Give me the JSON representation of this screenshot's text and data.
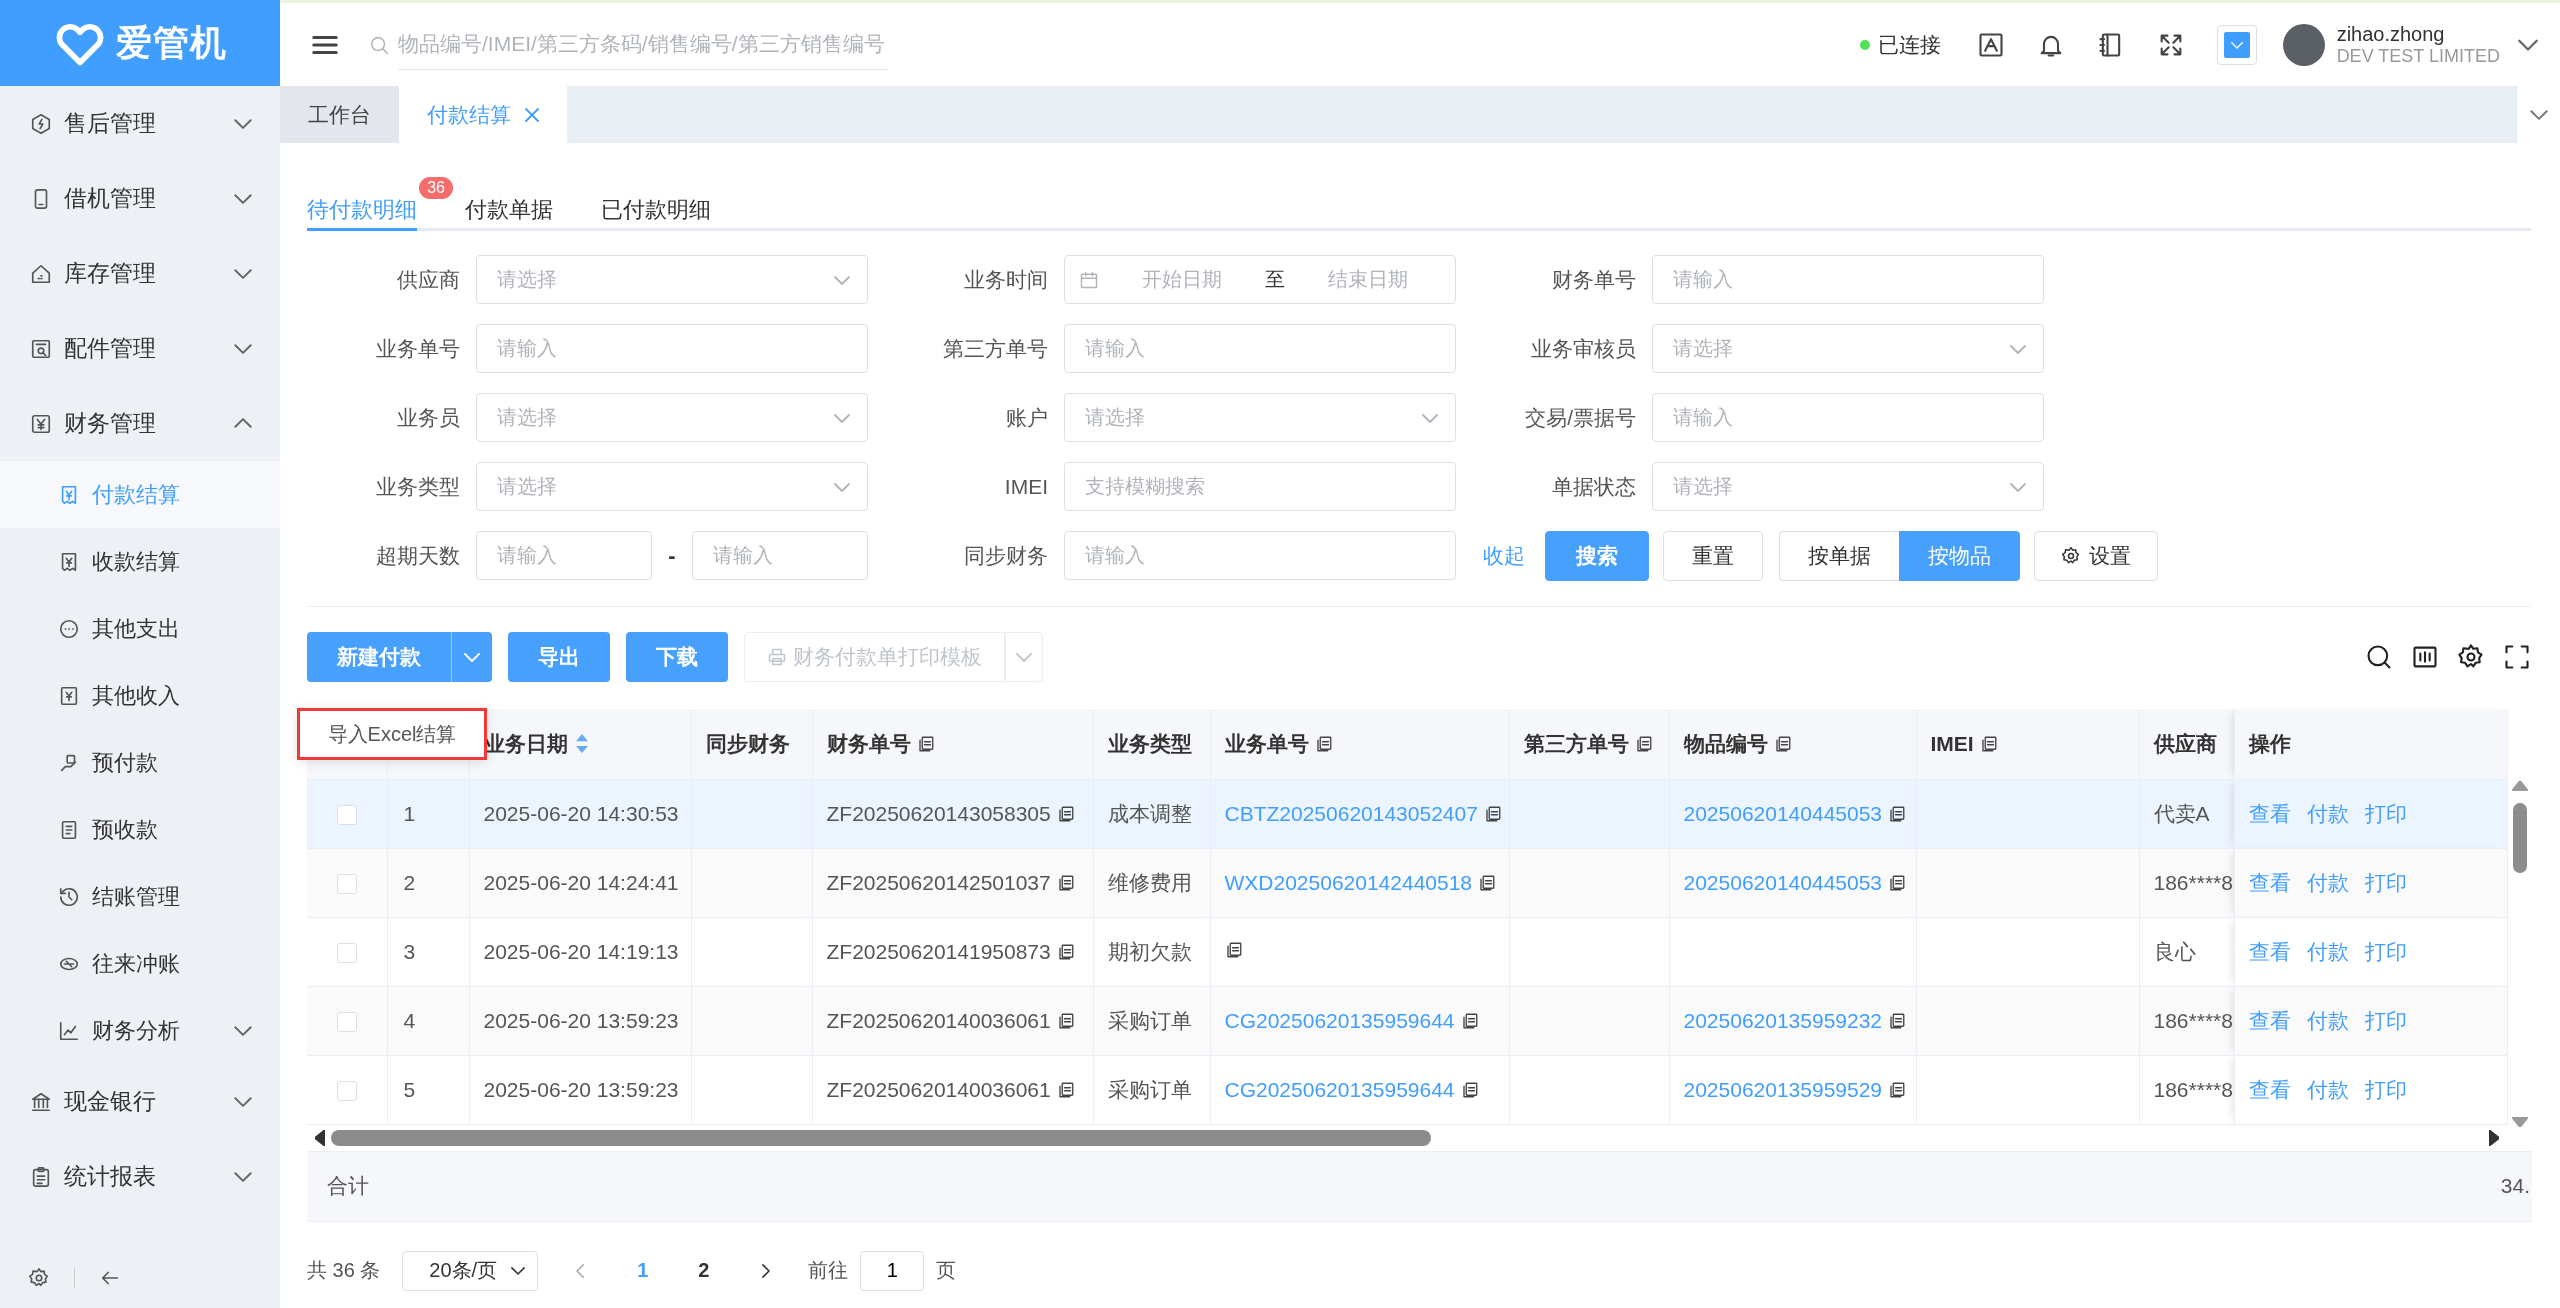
{
  "sidebar": {
    "logo": "爱管机",
    "items": [
      {
        "label": "售后管理",
        "expanded": false,
        "selected": false
      },
      {
        "label": "借机管理",
        "expanded": false,
        "selected": false
      },
      {
        "label": "库存管理",
        "expanded": false,
        "selected": false
      },
      {
        "label": "配件管理",
        "expanded": false,
        "selected": false
      },
      {
        "label": "财务管理",
        "expanded": true,
        "selected": false,
        "children": [
          {
            "label": "付款结算",
            "selected": true
          },
          {
            "label": "收款结算",
            "selected": false
          },
          {
            "label": "其他支出",
            "selected": false
          },
          {
            "label": "其他收入",
            "selected": false
          },
          {
            "label": "预付款",
            "selected": false
          },
          {
            "label": "预收款",
            "selected": false
          },
          {
            "label": "结账管理",
            "selected": false
          },
          {
            "label": "往来冲账",
            "selected": false
          },
          {
            "label": "财务分析",
            "selected": false,
            "expanded": false
          }
        ]
      },
      {
        "label": "现金银行",
        "expanded": false,
        "selected": false
      },
      {
        "label": "统计报表",
        "expanded": false,
        "selected": false
      }
    ]
  },
  "header": {
    "search": {
      "placeholder": "物品编号/IMEI/第三方条码/销售编号/第三方销售编号"
    },
    "connection": {
      "label": "已连接",
      "connected": true
    },
    "user": {
      "name": "zihao.zhong",
      "company": "DEV TEST LIMITED"
    }
  },
  "tabs": [
    {
      "label": "工作台",
      "selected": false,
      "closable": false
    },
    {
      "label": "付款结算",
      "selected": true,
      "closable": true
    }
  ],
  "subtabs": [
    {
      "label": "待付款明细",
      "selected": true,
      "badge": "36"
    },
    {
      "label": "付款单据",
      "selected": false
    },
    {
      "label": "已付款明细",
      "selected": false
    }
  ],
  "filters": [
    {
      "label": "供应商",
      "kind": "select",
      "placeholder": "请选择"
    },
    {
      "label": "业务时间",
      "kind": "daterange",
      "start_placeholder": "开始日期",
      "separator": "至",
      "end_placeholder": "结束日期"
    },
    {
      "label": "财务单号",
      "kind": "input",
      "placeholder": "请输入"
    },
    {
      "label": "业务单号",
      "kind": "input",
      "placeholder": "请输入"
    },
    {
      "label": "第三方单号",
      "kind": "input",
      "placeholder": "请输入"
    },
    {
      "label": "业务审核员",
      "kind": "select",
      "placeholder": "请选择"
    },
    {
      "label": "业务员",
      "kind": "select",
      "placeholder": "请选择"
    },
    {
      "label": "账户",
      "kind": "select",
      "placeholder": "请选择"
    },
    {
      "label": "交易/票据号",
      "kind": "input",
      "placeholder": "请输入"
    },
    {
      "label": "业务类型",
      "kind": "select",
      "placeholder": "请选择"
    },
    {
      "label": "IMEI",
      "kind": "input",
      "placeholder": "支持模糊搜索"
    },
    {
      "label": "单据状态",
      "kind": "select",
      "placeholder": "请选择"
    },
    {
      "label": "超期天数",
      "kind": "numrange",
      "start_placeholder": "请输入",
      "separator": "-",
      "end_placeholder": "请输入"
    },
    {
      "label": "同步财务",
      "kind": "input",
      "placeholder": "请输入"
    }
  ],
  "filter_actions": {
    "collapse": "收起",
    "search": "搜索",
    "reset": "重置",
    "view_modes": [
      {
        "label": "按单据",
        "selected": false
      },
      {
        "label": "按物品",
        "selected": true
      }
    ],
    "settings": "设置"
  },
  "toolbar": [
    {
      "label": "新建付款",
      "kind": "split",
      "disabled": false
    },
    {
      "label": "导出",
      "kind": "button",
      "disabled": false
    },
    {
      "label": "下载",
      "kind": "button",
      "disabled": false
    },
    {
      "label": "财务付款单打印模板",
      "kind": "split",
      "disabled": true
    }
  ],
  "dropdown_menu": {
    "items": [
      "导入Excel结算"
    ]
  },
  "table": {
    "columns": [
      {
        "kind": "checkbox"
      },
      {
        "kind": "index"
      },
      {
        "kind": "text",
        "label": "业务日期",
        "sortable": true,
        "copy": false
      },
      {
        "kind": "text",
        "label": "同步财务",
        "sortable": false,
        "copy": false
      },
      {
        "kind": "text",
        "label": "财务单号",
        "sortable": false,
        "copy": true
      },
      {
        "kind": "text",
        "label": "业务类型",
        "sortable": false,
        "copy": false
      },
      {
        "kind": "text",
        "label": "业务单号",
        "sortable": false,
        "copy": true
      },
      {
        "kind": "text",
        "label": "第三方单号",
        "sortable": false,
        "copy": true
      },
      {
        "kind": "text",
        "label": "物品编号",
        "sortable": false,
        "copy": true
      },
      {
        "kind": "text",
        "label": "IMEI",
        "sortable": false,
        "copy": true
      },
      {
        "kind": "text",
        "label": "供应商",
        "sortable": false,
        "copy": false
      },
      {
        "kind": "actions",
        "label": "操作"
      }
    ],
    "rows": [
      {
        "checked": false,
        "highlighted": true,
        "cells": [
          {},
          {
            "text": "1"
          },
          {
            "text": "2025-06-20 14:30:53"
          },
          {},
          {
            "text": "ZF20250620143058305",
            "copy": true
          },
          {
            "text": "成本调整"
          },
          {
            "text": "CBTZ20250620143052407",
            "link": true,
            "copy": true
          },
          {},
          {
            "text": "20250620140445053",
            "link": true,
            "copy": true
          },
          {},
          {
            "text": "代卖A"
          }
        ],
        "actions": [
          "查看",
          "付款",
          "打印"
        ]
      },
      {
        "checked": false,
        "highlighted": false,
        "cells": [
          {},
          {
            "text": "2"
          },
          {
            "text": "2025-06-20 14:24:41"
          },
          {},
          {
            "text": "ZF20250620142501037",
            "copy": true
          },
          {
            "text": "维修费用"
          },
          {
            "text": "WXD20250620142440518",
            "link": true,
            "copy": true
          },
          {},
          {
            "text": "20250620140445053",
            "link": true,
            "copy": true
          },
          {},
          {
            "text": "186****8"
          }
        ],
        "actions": [
          "查看",
          "付款",
          "打印"
        ]
      },
      {
        "checked": false,
        "highlighted": false,
        "cells": [
          {},
          {
            "text": "3"
          },
          {
            "text": "2025-06-20 14:19:13"
          },
          {},
          {
            "text": "ZF20250620141950873",
            "copy": true
          },
          {
            "text": "期初欠款"
          },
          {
            "copy": true
          },
          {},
          {},
          {},
          {
            "text": "良心"
          }
        ],
        "actions": [
          "查看",
          "付款",
          "打印"
        ]
      },
      {
        "checked": false,
        "highlighted": false,
        "cells": [
          {},
          {
            "text": "4"
          },
          {
            "text": "2025-06-20 13:59:23"
          },
          {},
          {
            "text": "ZF20250620140036061",
            "copy": true
          },
          {
            "text": "采购订单"
          },
          {
            "text": "CG20250620135959644",
            "link": true,
            "copy": true
          },
          {},
          {
            "text": "20250620135959232",
            "link": true,
            "copy": true
          },
          {},
          {
            "text": "186****8"
          }
        ],
        "actions": [
          "查看",
          "付款",
          "打印"
        ]
      },
      {
        "checked": false,
        "highlighted": false,
        "cells": [
          {},
          {
            "text": "5"
          },
          {
            "text": "2025-06-20 13:59:23"
          },
          {},
          {
            "text": "ZF20250620140036061",
            "copy": true
          },
          {
            "text": "采购订单"
          },
          {
            "text": "CG20250620135959644",
            "link": true,
            "copy": true
          },
          {},
          {
            "text": "20250620135959529",
            "link": true,
            "copy": true
          },
          {},
          {
            "text": "186****8"
          }
        ],
        "actions": [
          "查看",
          "付款",
          "打印"
        ]
      }
    ],
    "footer": {
      "label": "合计",
      "total": "34."
    }
  },
  "pagination": {
    "total": "共 36 条",
    "page_size": "20条/页",
    "pages": [
      {
        "label": "1",
        "selected": true
      },
      {
        "label": "2",
        "selected": false
      }
    ],
    "goto_label": "前往",
    "goto_value": "1",
    "goto_suffix": "页"
  }
}
